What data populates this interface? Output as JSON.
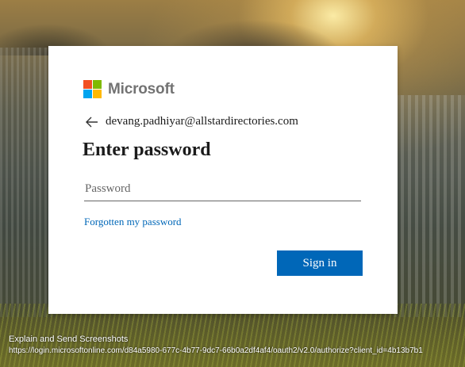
{
  "background": {
    "description_colors": {
      "sun": "#ffeaa0",
      "city": "#4a4f49",
      "grass": "#6e6e28"
    }
  },
  "login": {
    "brand": "Microsoft",
    "logo_colors": [
      "#f25022",
      "#7fba00",
      "#00a4ef",
      "#ffb900"
    ],
    "identity_email": "devang.padhiyar@allstardirectories.com",
    "back_icon": "back-arrow-icon",
    "title": "Enter password",
    "password_placeholder": "Password",
    "password_value": "",
    "forgot_link": "Forgotten my password",
    "signin_label": "Sign in",
    "accent_color": "#0067b8"
  },
  "overlay": {
    "title": "Explain and Send Screenshots",
    "url": "https://login.microsoftonline.com/d84a5980-677c-4b77-9dc7-66b0a2df4af4/oauth2/v2.0/authorize?client_id=4b13b7b1"
  }
}
